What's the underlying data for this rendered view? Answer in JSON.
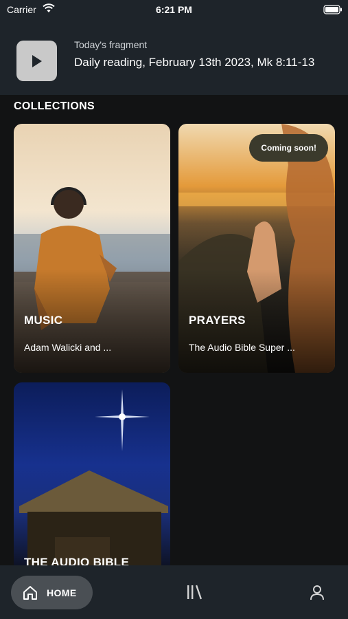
{
  "status_bar": {
    "carrier": "Carrier",
    "time": "6:21 PM"
  },
  "fragment": {
    "label": "Today's fragment",
    "title": "Daily reading, February 13th 2023, Mk 8:11-13",
    "icon": "play-icon"
  },
  "collections": {
    "heading": "COLLECTIONS",
    "cards": [
      {
        "title": "MUSIC",
        "subtitle": "Adam Walicki and ..."
      },
      {
        "title": "PRAYERS",
        "subtitle": "The Audio Bible Super ...",
        "badge": "Coming soon!"
      },
      {
        "title": "THE AUDIO BIBLE"
      }
    ]
  },
  "tab_bar": {
    "home_label": "HOME",
    "items": [
      "home-icon",
      "library-icon",
      "profile-icon"
    ]
  },
  "colors": {
    "background": "#121314",
    "header": "#1e242a",
    "tab_active": "#4a4f54",
    "badge": "#3b3a2c"
  }
}
